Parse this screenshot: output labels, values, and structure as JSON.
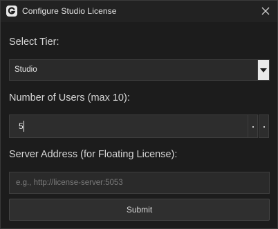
{
  "window": {
    "title": "Configure Studio License",
    "app_icon": "g-logo-icon",
    "close_icon": "close-icon"
  },
  "tier": {
    "label": "Select Tier:",
    "selected": "Studio"
  },
  "users": {
    "label": "Number of Users (max 10):",
    "value": "5"
  },
  "server": {
    "label": "Server Address (for Floating License):",
    "placeholder": "e.g., http://license-server:5053",
    "value": ""
  },
  "submit": {
    "label": "Submit"
  },
  "colors": {
    "background": "#1c1c1c",
    "field": "#2a2a2a",
    "text": "#d6d6d6"
  }
}
